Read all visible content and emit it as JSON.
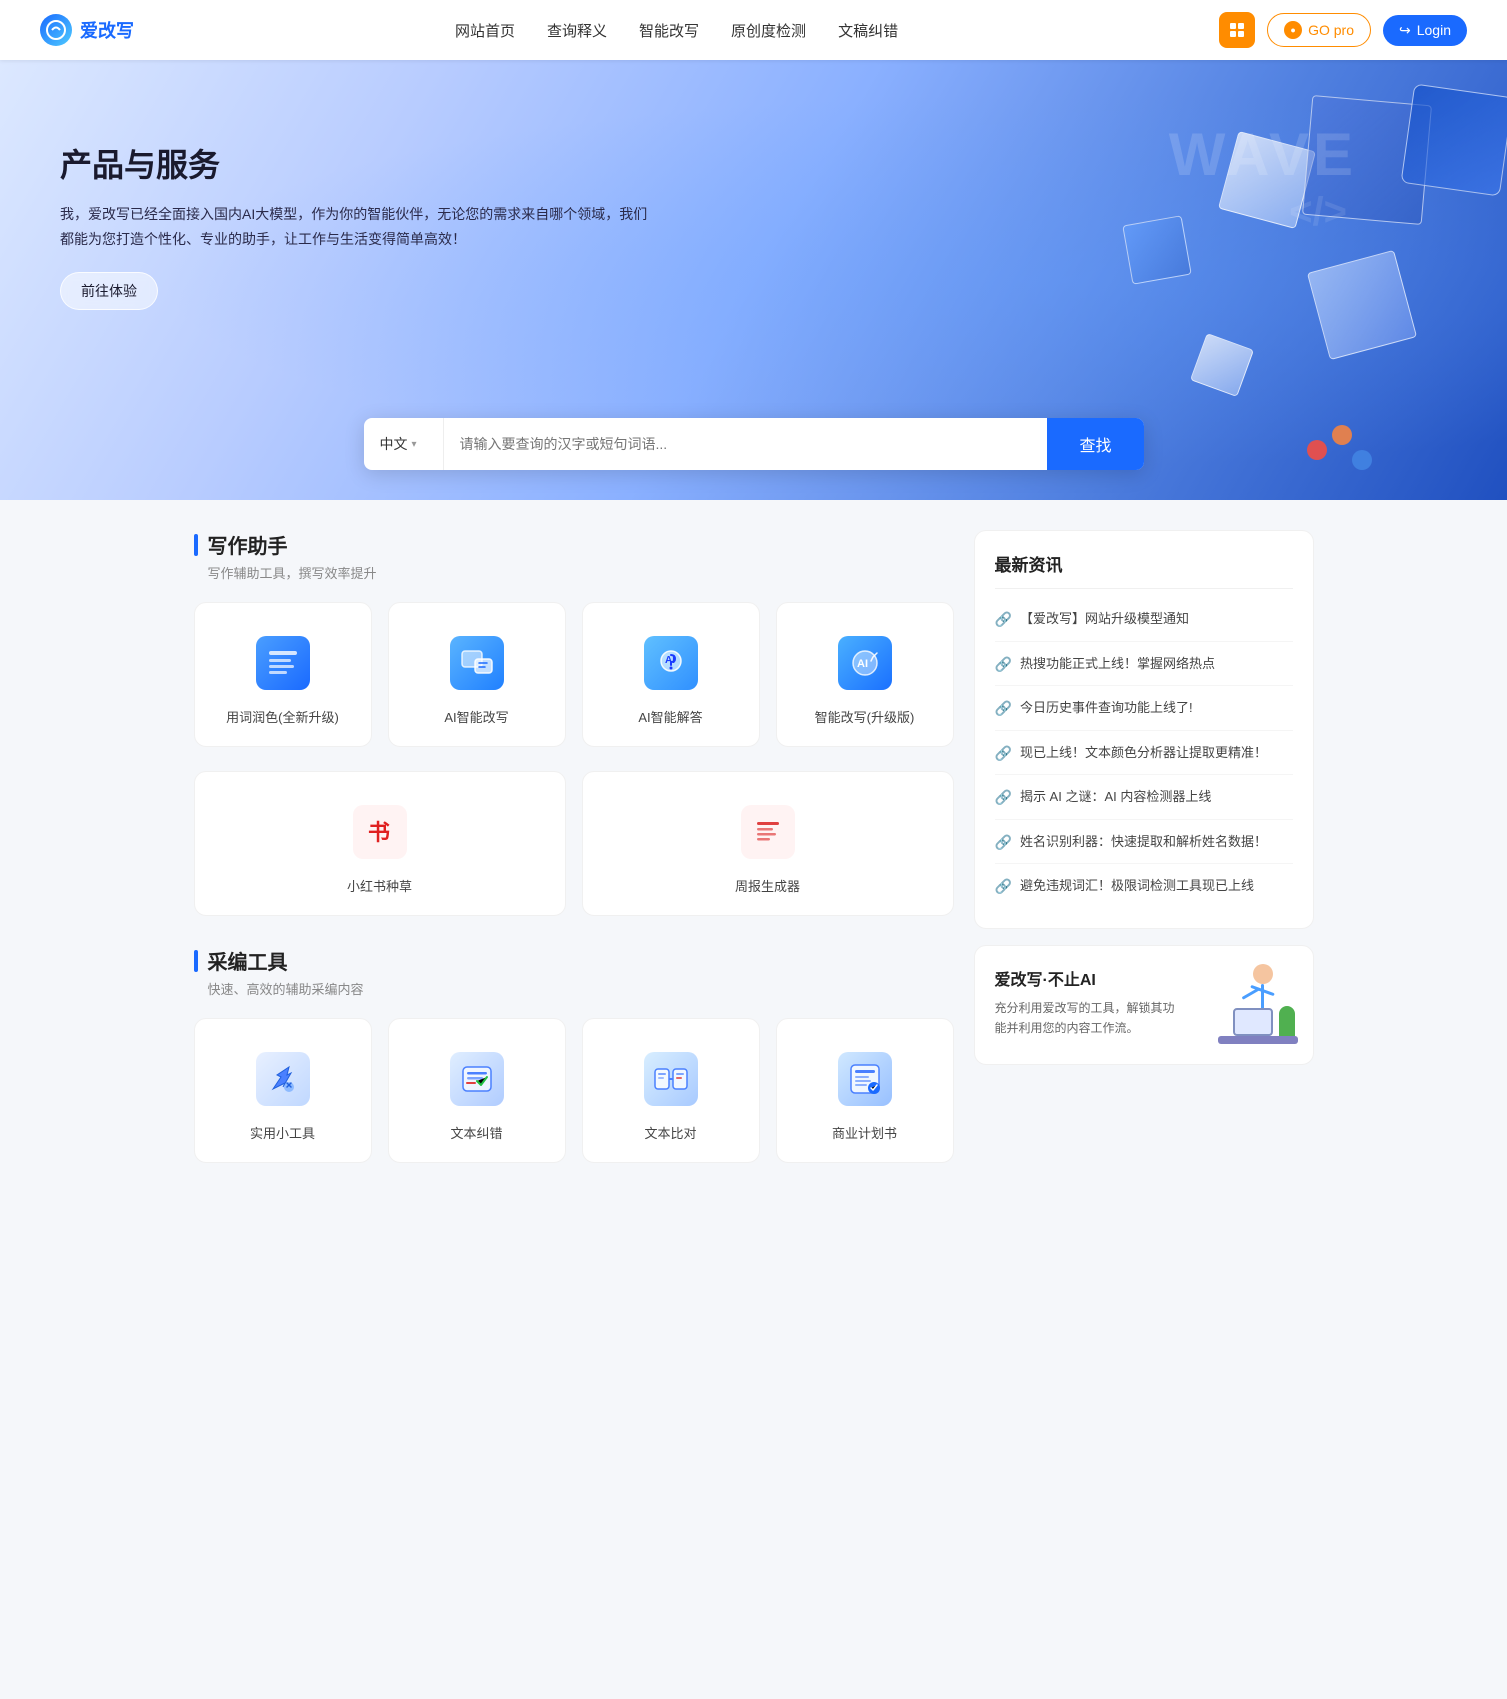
{
  "header": {
    "logo_text": "爱改写",
    "nav": [
      {
        "label": "网站首页",
        "href": "#"
      },
      {
        "label": "查询释义",
        "href": "#"
      },
      {
        "label": "智能改写",
        "href": "#"
      },
      {
        "label": "原创度检测",
        "href": "#"
      },
      {
        "label": "文稿纠错",
        "href": "#"
      }
    ],
    "btn_grid_label": "grid",
    "btn_go_pro": "GO pro",
    "btn_login": "Login"
  },
  "hero": {
    "title": "产品与服务",
    "desc": "我，爱改写已经全面接入国内AI大模型，作为你的智能伙伴，无论您的需求来自哪个领域，我们都能为您打造个性化、专业的助手，让工作与生活变得简单高效！",
    "btn_experience": "前往体验",
    "search": {
      "lang": "中文",
      "placeholder": "请输入要查询的汉字或短句词语...",
      "btn": "查找"
    }
  },
  "writing_section": {
    "title": "写作助手",
    "sub": "写作辅助工具，撰写效率提升",
    "tools": [
      {
        "label": "用词润色(全新升级)",
        "icon": "writing-polish-icon"
      },
      {
        "label": "AI智能改写",
        "icon": "ai-rewrite-icon"
      },
      {
        "label": "AI智能解答",
        "icon": "ai-answer-icon"
      },
      {
        "label": "智能改写(升级版)",
        "icon": "smart-rewrite-icon"
      },
      {
        "label": "小红书种草",
        "icon": "xiaohongshu-icon"
      },
      {
        "label": "周报生成器",
        "icon": "weekly-report-icon"
      }
    ]
  },
  "editing_section": {
    "title": "采编工具",
    "sub": "快速、高效的辅助采编内容",
    "tools": [
      {
        "label": "实用小工具",
        "icon": "tools-icon"
      },
      {
        "label": "文本纠错",
        "icon": "text-correct-icon"
      },
      {
        "label": "文本比对",
        "icon": "text-compare-icon"
      },
      {
        "label": "商业计划书",
        "icon": "business-plan-icon"
      }
    ]
  },
  "news": {
    "title": "最新资讯",
    "items": [
      {
        "text": "【爱改写】网站升级模型通知"
      },
      {
        "text": "热搜功能正式上线！掌握网络热点"
      },
      {
        "text": "今日历史事件查询功能上线了!"
      },
      {
        "text": "现已上线！文本颜色分析器让提取更精准！"
      },
      {
        "text": "揭示 AI 之谜：AI 内容检测器上线"
      },
      {
        "text": "姓名识别利器：快速提取和解析姓名数据！"
      },
      {
        "text": "避免违规词汇！极限词检测工具现已上线"
      }
    ]
  },
  "promo": {
    "title": "爱改写·不止AI",
    "desc": "充分利用爱改写的工具，解锁其功能并利用您的内容工作流。"
  },
  "colors": {
    "primary": "#1a6aff",
    "orange": "#ff8c00",
    "red": "#e02020"
  }
}
